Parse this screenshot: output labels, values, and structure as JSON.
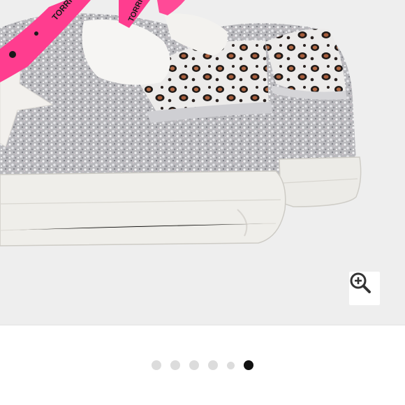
{
  "gallery": {
    "image_name": "glitter-leopard-sneakers",
    "lace_print_text": "TORRI",
    "zoom_icon": "zoom-in-icon"
  },
  "pagination": {
    "total": 6,
    "active_index": 5,
    "small_indices": [
      4
    ]
  },
  "colors": {
    "gallery_background": "#eeeeee",
    "active_dot": "#111111",
    "inactive_dot": "#dcdcdc",
    "lace_pink": "#ff3d8f"
  }
}
